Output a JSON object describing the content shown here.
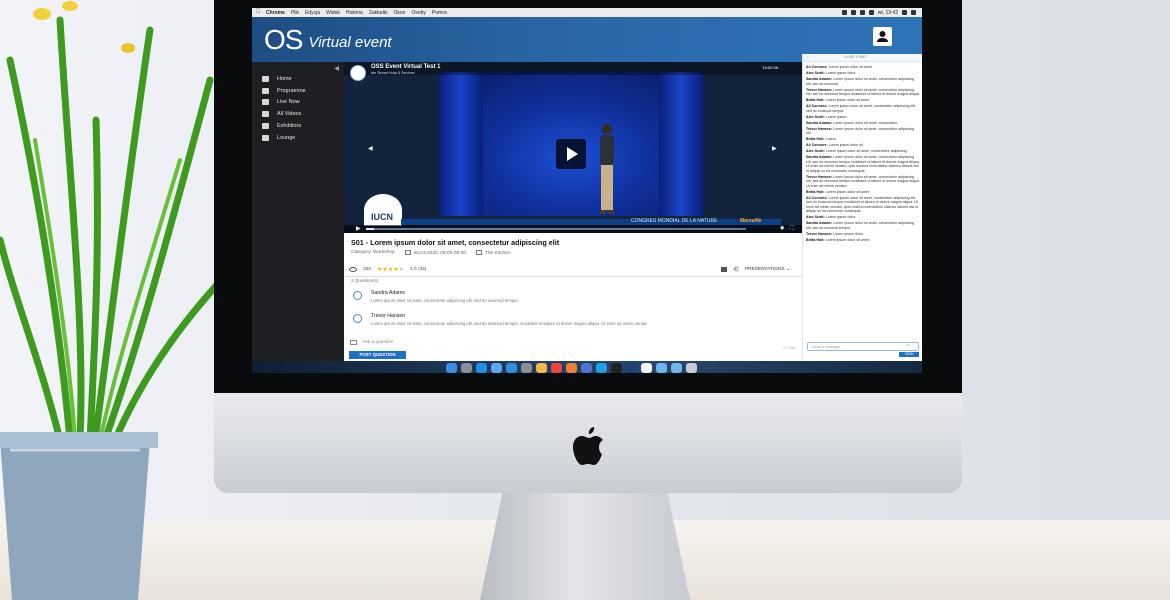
{
  "menubar": {
    "items": [
      "Chrome",
      "Plik",
      "Edycja",
      "Widok",
      "Historia",
      "Zakładki",
      "Okno",
      "Osoby",
      "Pomoc"
    ],
    "clock": "wt. 13:42"
  },
  "header": {
    "logo": "OS",
    "title": "Virtual event",
    "user_icon": "user-icon"
  },
  "sidebar": {
    "items": [
      {
        "label": "Home",
        "icon": "home-icon"
      },
      {
        "label": "Programme",
        "icon": "calendar-icon"
      },
      {
        "label": "Live Now",
        "icon": "live-icon"
      },
      {
        "label": "All Videos",
        "icon": "video-icon"
      },
      {
        "label": "Exhibitors",
        "icon": "booth-icon"
      },
      {
        "label": "Lounge",
        "icon": "lounge-icon"
      }
    ]
  },
  "video": {
    "event_title": "OSS Event Virtual Test 1",
    "event_subtitle": "live Stream Nota & Services",
    "time": "15:50:38",
    "banner_text": "CONGRES MONDIAL DE LA NATURE",
    "banner_city": "Marseille",
    "logo_text": "IUCN",
    "progress_fraction": 0.02,
    "colors": {
      "stage": "#1d4fd4",
      "banner": "#0c3e86"
    }
  },
  "session": {
    "title": "S01 - Lorem ipsum dolor sit amet, consectetur adipiscing elit",
    "category": "Category: Workshop",
    "date": "25.03.2020, 08:00-09:00",
    "room": "The Kitchen",
    "views": "256",
    "rating_value": 4,
    "rating_text": "4.0 (35)",
    "presentations_label": "PRESENTATIONS"
  },
  "questions": {
    "count_label": "2 Question(s)",
    "items": [
      {
        "name": "Sandra Adams",
        "text": "Lorem ipsum dolor sit amet, consectetur adipiscing elit, sed do eiusmod tempor."
      },
      {
        "name": "Trevor Hansen",
        "text": "Lorem ipsum dolor sit amet, consectetur adipiscing elit, sed do eiusmod tempor, incididunt ut labore et dolore magna aliqua. Ut enim ad minim veniat."
      }
    ],
    "ask_placeholder": "Ask a question",
    "char_count": "0 / 300",
    "post_label": "POST QUESTION"
  },
  "chat": {
    "header": "LIVE CHAT",
    "messages": [
      {
        "author": "Ali Connors:",
        "text": "Lorem ipsum dolor sit amet"
      },
      {
        "author": "Alex Scott:",
        "text": "Lorem ipsum dolor."
      },
      {
        "author": "Sandra Adams:",
        "text": "Lorem ipsum dolor sit amet, consectetur adipiscing elit, sed do eiusmod."
      },
      {
        "author": "Trevor Hansen:",
        "text": "Lorem ipsum dolor sit amet, consectetur adipiscing elit, sed do eiusmod tempor incididunt ut labore et dolore magna aliqua."
      },
      {
        "author": "Britta Holt:",
        "text": "Lorem ipsum dolor sit amet."
      },
      {
        "author": "Ali Connors:",
        "text": "Lorem ipsum dolor sit amet, consectetur adipiscing elit, sed do eiusmod tempor."
      },
      {
        "author": "Alex Scott:",
        "text": "Lorem ipsum."
      },
      {
        "author": "Sandra Adams:",
        "text": "Lorem ipsum dolor sit amet, consectetur."
      },
      {
        "author": "Trevor Hansen:",
        "text": "Lorem ipsum dolor sit amet, consectetur adipiscing elit."
      },
      {
        "author": "Britta Holt:",
        "text": "Lorem."
      },
      {
        "author": "Ali Connors:",
        "text": "Lorem ipsum dolor sit."
      },
      {
        "author": "Alex Scott:",
        "text": "Lorem ipsum dolor sit amet, consectetur adipiscing."
      },
      {
        "author": "Sandra Adams:",
        "text": "Lorem ipsum dolor sit amet, consectetur adipiscing elit, sed do eiusmod tempor incididunt ut labore et dolore magna aliqua. Ut enim ad minim veniam, quis nostrud exercitation ullamco laboris nisi ut aliquip ex ea commodo consequat."
      },
      {
        "author": "Trevor Hansen:",
        "text": "Lorem ipsum dolor sit amet, consectetur adipiscing elit, sed do eiusmod tempor incididunt ut labore et dolore magna aliqua. Ut enim ad minim veniam."
      },
      {
        "author": "Britta Holt:",
        "text": "Lorem ipsum dolor sit amet."
      },
      {
        "author": "Ali Connors:",
        "text": "Lorem ipsum dolor sit amet, consectetur adipiscing elit, sed do eiusmod tempor incididunt ut labore et dolore magna aliqua. Ut enim ad minim veniam, quis nostrud exercitation ullamco laboris nisi ut aliquip ex ea commodo consequat."
      },
      {
        "author": "Alex Scott:",
        "text": "Lorem ipsum dolor."
      },
      {
        "author": "Sandra Adams:",
        "text": "Lorem ipsum dolor sit amet, consectetur adipiscing elit, sed do eiusmod tempor."
      },
      {
        "author": "Trevor Hansen:",
        "text": "Lorem ipsum dolor."
      },
      {
        "author": "Britta Holt:",
        "text": "Lorem ipsum dolor sit amet."
      }
    ],
    "input_placeholder": "Send a message",
    "input_count": "0/2",
    "send_label": "SEND"
  },
  "dock": {
    "icons": [
      "finder-icon",
      "launchpad-icon",
      "safari-icon",
      "mail-icon",
      "appstore-icon",
      "preferences-icon",
      "photos-icon",
      "chrome-icon",
      "firefox-icon",
      "app-icon",
      "skype-icon",
      "terminal-icon",
      "photoshop-icon",
      "notes-icon",
      "folder-icon",
      "folder-icon",
      "trash-icon"
    ],
    "colors": [
      "#3a8ee6",
      "#8a8f9a",
      "#1f8fe8",
      "#5aa7f2",
      "#2f8fe0",
      "#8b8f95",
      "#f2b84b",
      "#e8473c",
      "#f1812e",
      "#4b74d1",
      "#1ba1e6",
      "#222",
      "#1c3f76",
      "#f5f5f5",
      "#6fb6f0",
      "#6fb6f0",
      "#c9ccd3"
    ]
  }
}
